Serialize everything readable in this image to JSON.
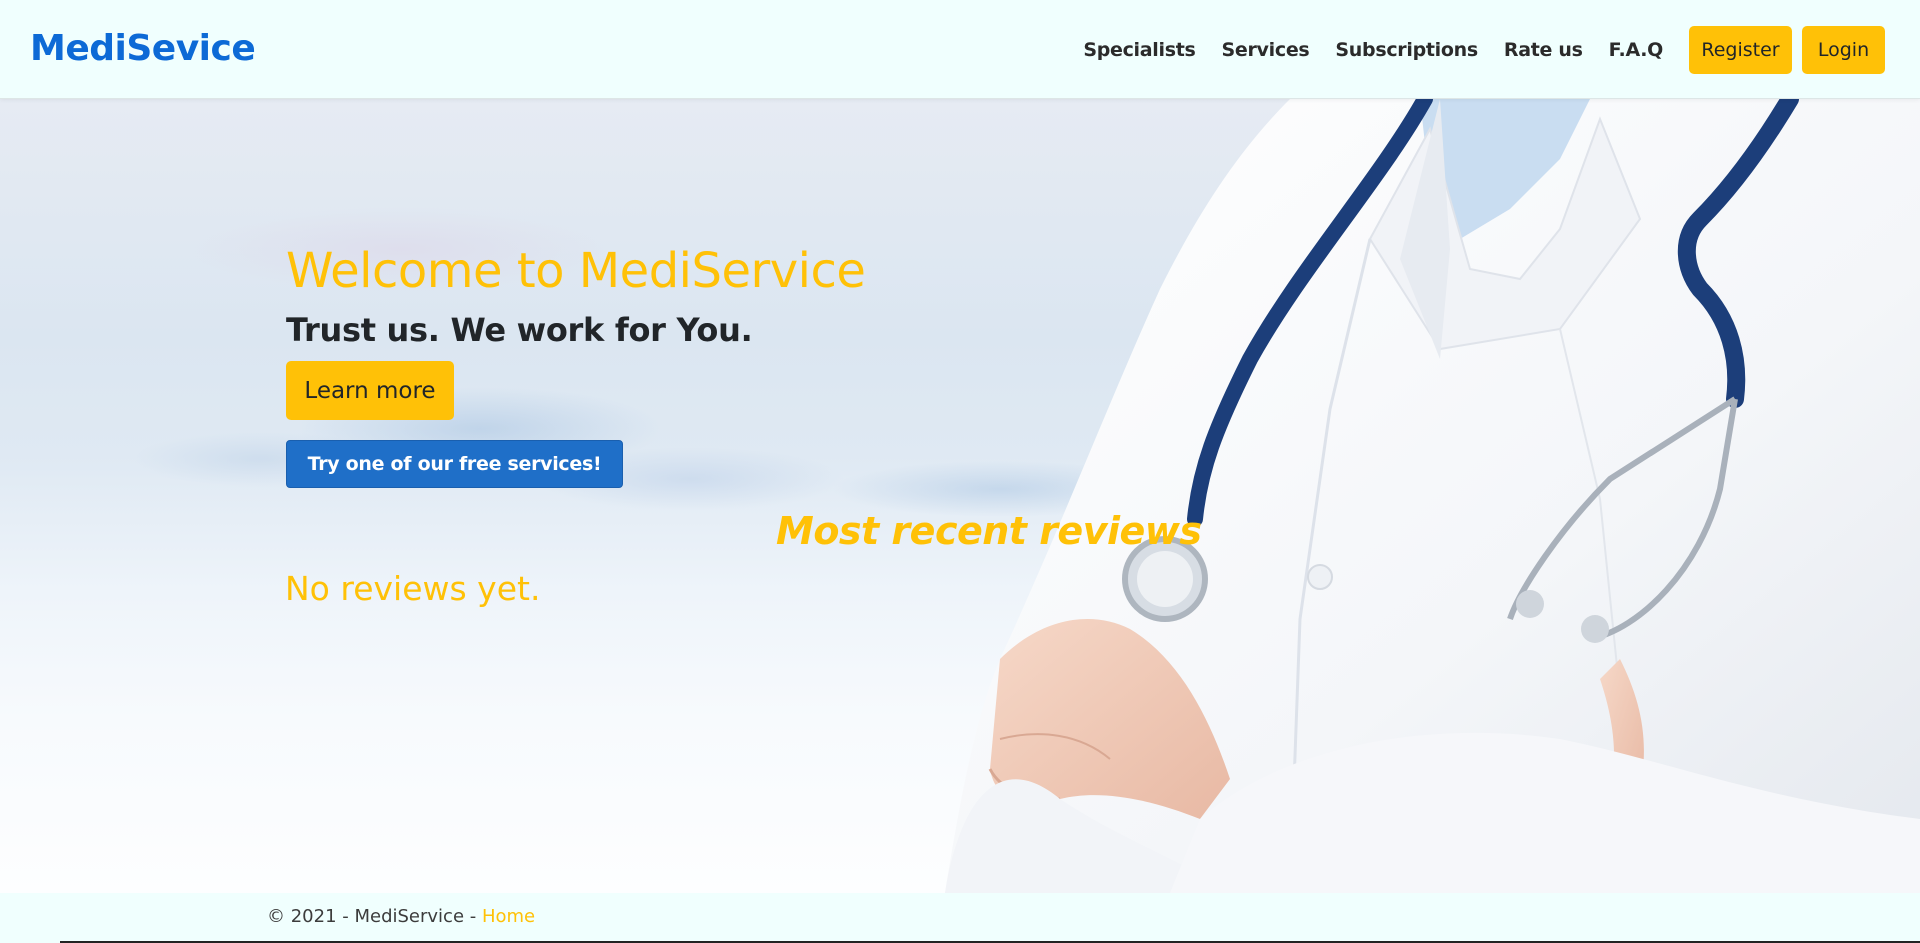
{
  "header": {
    "brand": "MediSevice",
    "nav": [
      "Specialists",
      "Services",
      "Subscriptions",
      "Rate us",
      "F.A.Q"
    ],
    "register_label": "Register",
    "login_label": "Login"
  },
  "hero": {
    "title": "Welcome to MediService",
    "subtitle": "Trust us. We work for You.",
    "learn_more_label": "Learn more",
    "free_services_label": "Try one of our free services!",
    "reviews_heading": "Most recent reviews",
    "no_reviews_text": "No reviews yet."
  },
  "footer": {
    "copyright": "© 2021 - MediService - ",
    "home_link": "Home"
  },
  "colors": {
    "brand": "#0d6ad6",
    "accent": "#ffc107",
    "primary": "#1f6fc8",
    "header_bg": "#f0fffe"
  }
}
